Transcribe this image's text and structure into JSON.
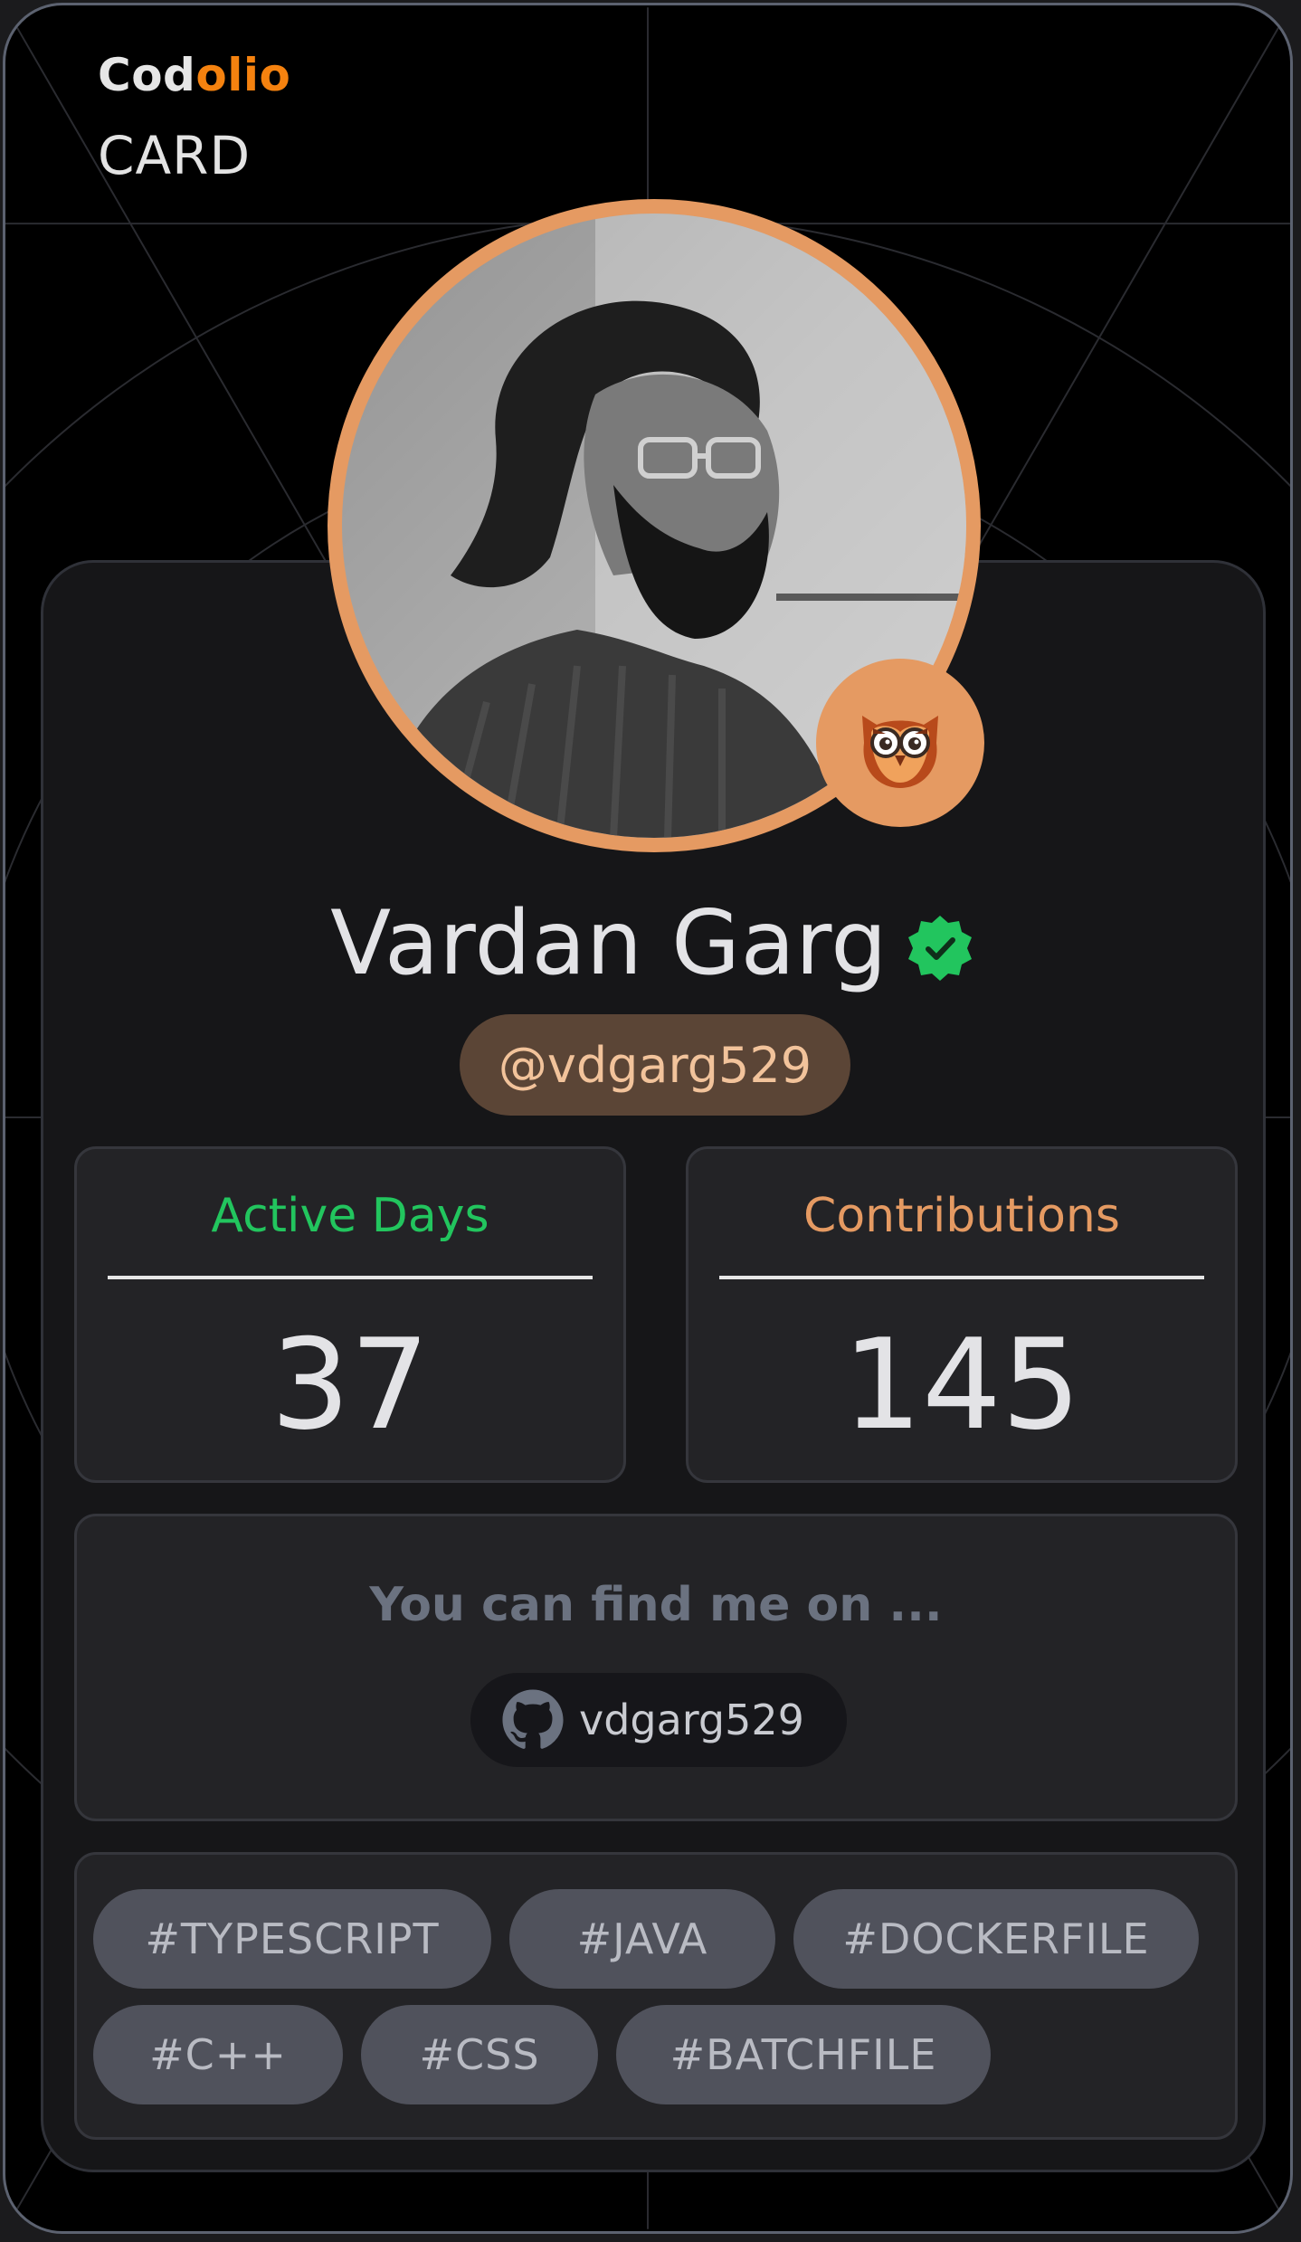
{
  "brand": {
    "prefix": "Cod",
    "accent": "olio",
    "subtitle": "CARD"
  },
  "profile": {
    "name": "Vardan Garg",
    "handle": "@vdgarg529",
    "avatar_description": "profile-photo",
    "badge_icon": "owl-icon",
    "verified_icon": "verified-check-icon"
  },
  "stats": [
    {
      "label": "Active Days",
      "value": "37"
    },
    {
      "label": "Contributions",
      "value": "145"
    }
  ],
  "find_me": {
    "title": "You can find me on ...",
    "links": [
      {
        "icon": "github-icon",
        "label": "vdgarg529"
      }
    ]
  },
  "tags": [
    "#TYPESCRIPT",
    "#JAVA",
    "#DOCKERFILE",
    "#C++",
    "#CSS",
    "#BATCHFILE"
  ],
  "colors": {
    "accent_orange": "#f5820f",
    "avatar_ring": "#e59a62",
    "active_green": "#22c55e",
    "handle_bg": "#5b4536",
    "handle_text": "#f2c39b"
  }
}
